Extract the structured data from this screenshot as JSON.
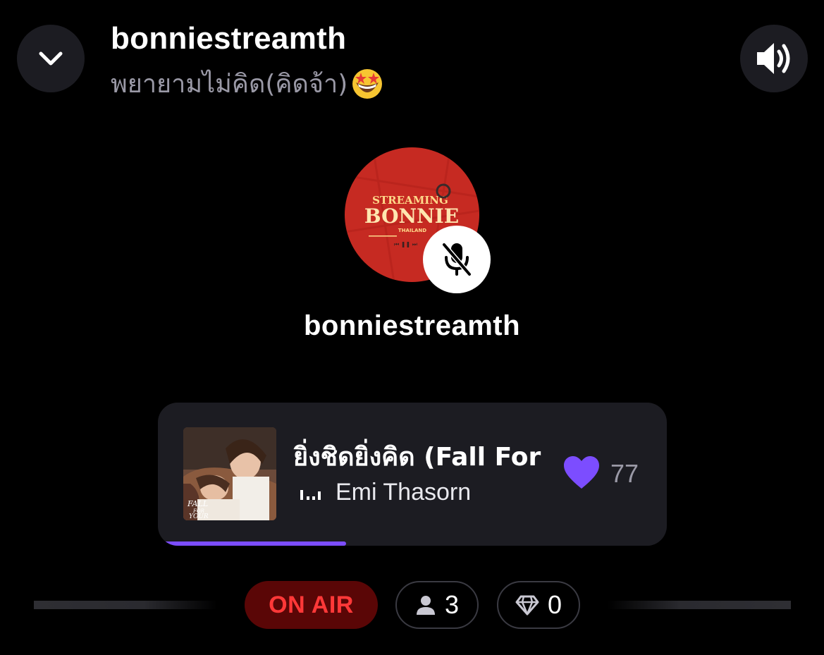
{
  "header": {
    "title": "bonniestreamth",
    "subtitle": "พยายามไม่คิด(คิดจ้า)",
    "collapse_icon": "chevron-down-icon",
    "volume_icon": "speaker-volume-icon"
  },
  "host": {
    "name": "bonniestreamth",
    "avatar_text": [
      "STREAMING",
      "BONNIE",
      "THAILAND"
    ],
    "muted": true,
    "mute_icon": "mic-off-icon"
  },
  "now_playing": {
    "title": "ยิ่งชิดยิ่งคิด (Fall For",
    "artist": "Emi Thasorn",
    "likes": "77",
    "album_art_text": [
      "FALL",
      "FOR",
      "YOUR"
    ],
    "progress_fraction": 0.37,
    "accent_color": "#7c4dff"
  },
  "status": {
    "on_air_label": "ON AIR",
    "listeners": "3",
    "gems": "0",
    "on_air_color": "#ff3838"
  },
  "colors": {
    "background": "#000000",
    "card": "#1c1c22",
    "muted_text": "#9a99a6"
  }
}
